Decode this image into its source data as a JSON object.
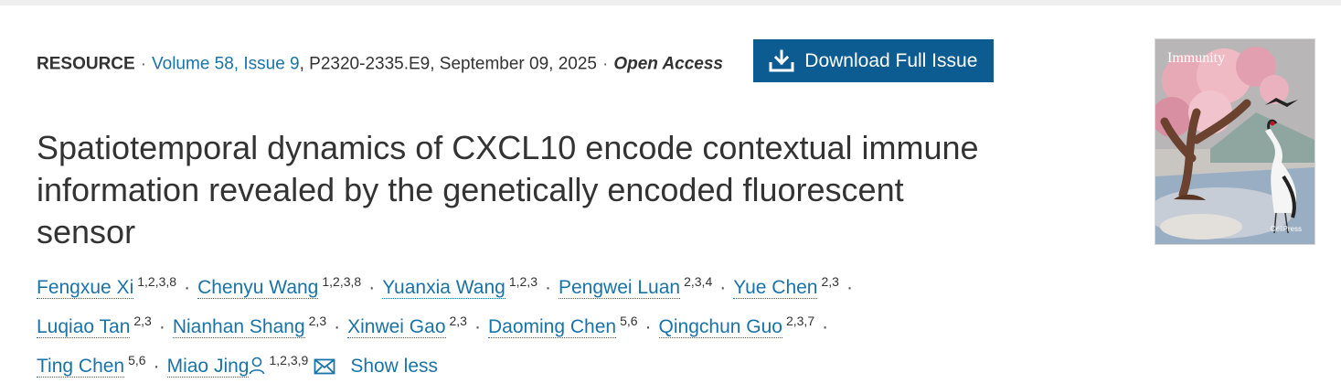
{
  "meta": {
    "type": "RESOURCE",
    "volume_issue": "Volume 58, Issue 9",
    "pages_date": ", P2320-2335.E9, September 09, 2025",
    "separator": "·",
    "open_access": "Open Access",
    "download_button": "Download Full Issue"
  },
  "title": "Spatiotemporal dynamics of CXCL10 encode contextual immune information revealed by the genetically encoded fluorescent sensor",
  "authors": [
    {
      "name": "Fengxue Xi",
      "aff": "1,2,3,8"
    },
    {
      "name": "Chenyu Wang",
      "aff": "1,2,3,8"
    },
    {
      "name": "Yuanxia Wang",
      "aff": "1,2,3"
    },
    {
      "name": "Pengwei Luan",
      "aff": "2,3,4"
    },
    {
      "name": "Yue Chen",
      "aff": "2,3"
    },
    {
      "name": "Luqiao Tan",
      "aff": "2,3"
    },
    {
      "name": "Nianhan Shang",
      "aff": "2,3"
    },
    {
      "name": "Xinwei Gao",
      "aff": "2,3"
    },
    {
      "name": "Daoming Chen",
      "aff": "5,6"
    },
    {
      "name": "Qingchun Guo",
      "aff": "2,3,7"
    },
    {
      "name": "Ting Chen",
      "aff": "5,6"
    },
    {
      "name": "Miao Jing",
      "aff": "1,2,3,9"
    }
  ],
  "show_less": "Show less",
  "cover": {
    "title": "Immunity",
    "publisher": "CellPress"
  },
  "icons": {
    "download": "download-icon",
    "person": "person-icon",
    "mail": "mail-icon"
  },
  "colors": {
    "link": "#1a73a8",
    "button_bg": "#0d5c91"
  }
}
